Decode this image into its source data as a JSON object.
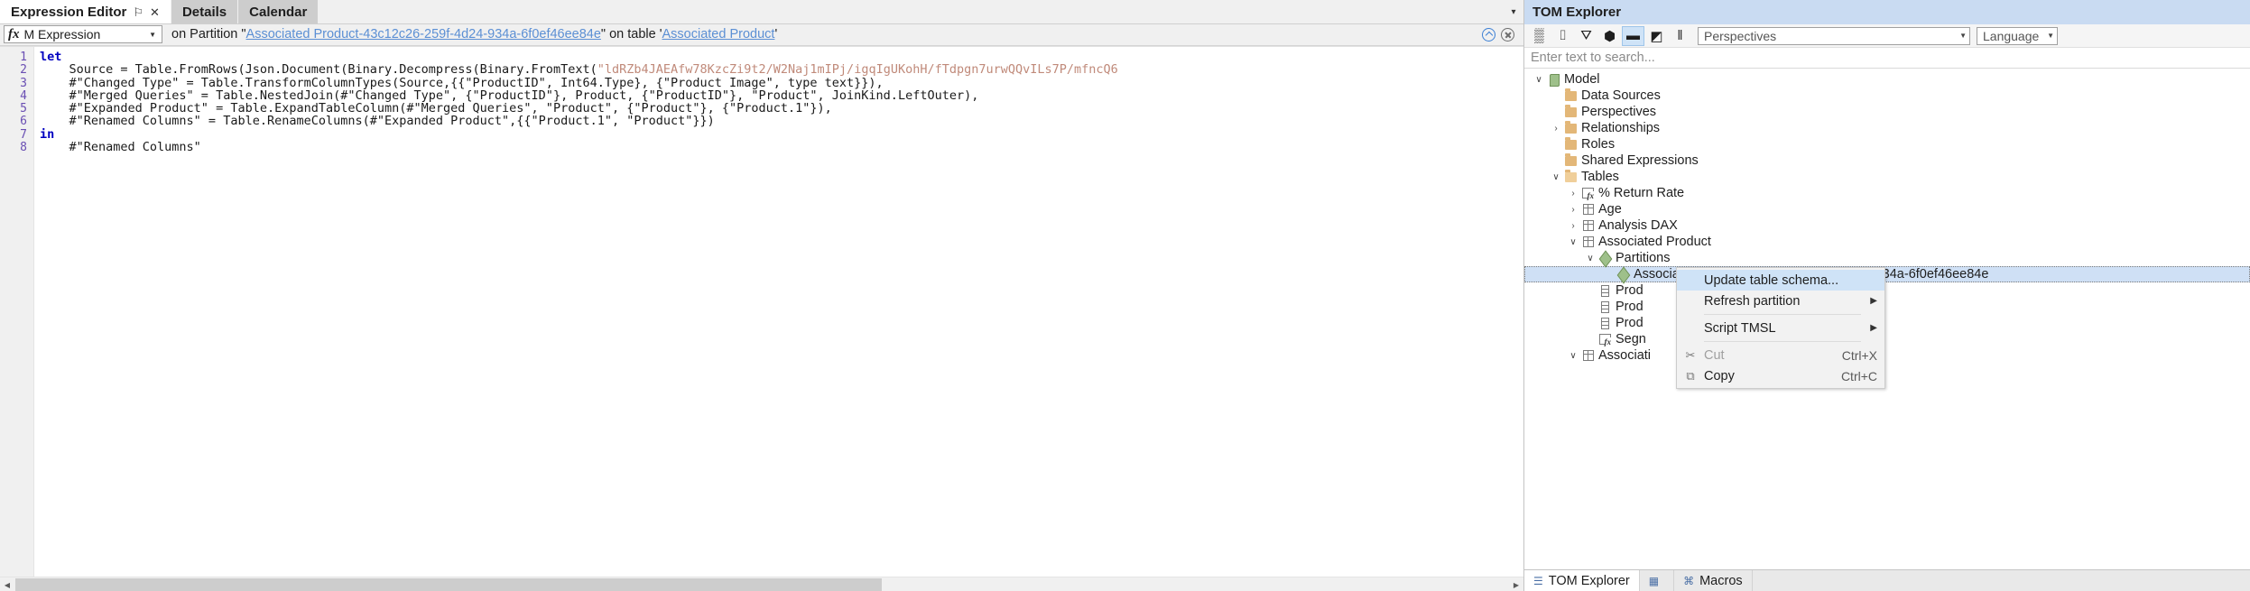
{
  "editor_pane": {
    "tabs": [
      {
        "label": "Expression Editor",
        "active": true,
        "pin": "⚐",
        "close": "✕"
      },
      {
        "label": "Details",
        "active": false,
        "pin": "",
        "close": ""
      },
      {
        "label": "Calendar",
        "active": false,
        "pin": "",
        "close": ""
      }
    ],
    "tabstrip_overflow_icon": "▾",
    "toolbar": {
      "fx_glyph": "fx",
      "expression_kind": "M Expression",
      "dropdown_arrow": "▼",
      "caption_prefix": "on Partition \"",
      "partition_link": "Associated Product-43c12c26-259f-4d24-934a-6f0ef46ee84e",
      "caption_middle": "\" on table '",
      "table_link": "Associated Product",
      "caption_suffix": "'",
      "refresh_icon": "refresh-circle-icon",
      "cancel_icon": "cancel-circle-icon"
    },
    "code_lines": [
      {
        "n": "1",
        "segments": [
          {
            "t": "let",
            "c": "kw"
          }
        ]
      },
      {
        "n": "2",
        "segments": [
          {
            "t": "    Source = Table.FromRows(Json.Document(Binary.Decompress(Binary.FromText(",
            "c": "plain"
          },
          {
            "t": "\"ldRZb4JAEAfw78KzcZi9t2/W2Naj1mIPj/igqIgUKohH/fTdpgn7urwQQvILs7P/mfncQ6",
            "c": "str"
          }
        ]
      },
      {
        "n": "3",
        "segments": [
          {
            "t": "    #\"Changed Type\" = Table.TransformColumnTypes(Source,{{\"ProductID\", Int64.Type}, {\"Product Image\", type text}}),",
            "c": "plain"
          }
        ]
      },
      {
        "n": "4",
        "segments": [
          {
            "t": "    #\"Merged Queries\" = Table.NestedJoin(#\"Changed Type\", {\"ProductID\"}, Product, {\"ProductID\"}, \"Product\", JoinKind.LeftOuter),",
            "c": "plain"
          }
        ]
      },
      {
        "n": "5",
        "segments": [
          {
            "t": "    #\"Expanded Product\" = Table.ExpandTableColumn(#\"Merged Queries\", \"Product\", {\"Product\"}, {\"Product.1\"}),",
            "c": "plain"
          }
        ]
      },
      {
        "n": "6",
        "segments": [
          {
            "t": "    #\"Renamed Columns\" = Table.RenameColumns(#\"Expanded Product\",{{\"Product.1\", \"Product\"}})",
            "c": "plain"
          }
        ]
      },
      {
        "n": "7",
        "segments": [
          {
            "t": "in",
            "c": "kw"
          }
        ]
      },
      {
        "n": "8",
        "segments": [
          {
            "t": "    #\"Renamed Columns\"",
            "c": "plain"
          }
        ]
      }
    ],
    "scroll_left_arrow": "◀",
    "scroll_right_arrow": "▶"
  },
  "tom_explorer": {
    "title": "TOM Explorer",
    "toolbar_buttons": [
      {
        "name": "measures-toggle-icon",
        "glyph": "▒",
        "selected": false
      },
      {
        "name": "columns-toggle-icon",
        "glyph": "⌷",
        "selected": false
      },
      {
        "name": "hierarchies-toggle-icon",
        "glyph": "⛛",
        "selected": false
      },
      {
        "name": "partitions-toggle-icon",
        "glyph": "⬢",
        "selected": false
      },
      {
        "name": "folders-toggle-icon",
        "glyph": "▬",
        "selected": true
      },
      {
        "name": "hidden-objects-toggle-icon",
        "glyph": "◩",
        "selected": false
      },
      {
        "name": "columns-view-icon",
        "glyph": "‖",
        "selected": false
      }
    ],
    "perspectives_combo": {
      "value": "Perspectives",
      "arrow": "▼"
    },
    "language_combo": {
      "value": "Language",
      "arrow": "▼"
    },
    "search_placeholder": "Enter text to search...",
    "tree": [
      {
        "depth": 0,
        "chev": "∨",
        "icon": "model-icon",
        "label": "Model"
      },
      {
        "depth": 1,
        "chev": "",
        "icon": "folder-icon",
        "label": "Data Sources"
      },
      {
        "depth": 1,
        "chev": "",
        "icon": "folder-icon",
        "label": "Perspectives"
      },
      {
        "depth": 1,
        "chev": "›",
        "icon": "folder-icon",
        "label": "Relationships"
      },
      {
        "depth": 1,
        "chev": "",
        "icon": "folder-icon",
        "label": "Roles"
      },
      {
        "depth": 1,
        "chev": "",
        "icon": "folder-icon",
        "label": "Shared Expressions"
      },
      {
        "depth": 1,
        "chev": "∨",
        "icon": "folder-open-icon",
        "label": "Tables"
      },
      {
        "depth": 2,
        "chev": "›",
        "icon": "measure-table-icon",
        "label": "% Return Rate"
      },
      {
        "depth": 2,
        "chev": "›",
        "icon": "table-icon",
        "label": "Age"
      },
      {
        "depth": 2,
        "chev": "›",
        "icon": "table-icon",
        "label": "Analysis DAX"
      },
      {
        "depth": 2,
        "chev": "∨",
        "icon": "table-icon",
        "label": "Associated Product"
      },
      {
        "depth": 3,
        "chev": "∨",
        "icon": "partition-icon",
        "label": "Partitions"
      },
      {
        "depth": 4,
        "chev": "",
        "icon": "partition-icon",
        "label": "Associated Product-43c12c26-259f-4d24-934a-6f0ef46ee84e",
        "selected": true
      },
      {
        "depth": 3,
        "chev": "",
        "icon": "column-icon",
        "label": "Prod"
      },
      {
        "depth": 3,
        "chev": "",
        "icon": "column-icon",
        "label": "Prod"
      },
      {
        "depth": 3,
        "chev": "",
        "icon": "column-icon",
        "label": "Prod"
      },
      {
        "depth": 3,
        "chev": "",
        "icon": "measure-table-icon",
        "label": "Segn"
      },
      {
        "depth": 2,
        "chev": "∨",
        "icon": "table-icon",
        "label": "Associati"
      }
    ],
    "context_menu": [
      {
        "label": "Update table schema...",
        "icon": "",
        "accel": "",
        "submenu": false,
        "highlight": true,
        "disabled": false,
        "separator_after": false
      },
      {
        "label": "Refresh partition",
        "icon": "",
        "accel": "",
        "submenu": true,
        "highlight": false,
        "disabled": false,
        "separator_after": true
      },
      {
        "label": "Script TMSL",
        "icon": "",
        "accel": "",
        "submenu": true,
        "highlight": false,
        "disabled": false,
        "separator_after": true
      },
      {
        "label": "Cut",
        "icon": "scissors-icon",
        "accel": "Ctrl+X",
        "submenu": false,
        "highlight": false,
        "disabled": true,
        "separator_after": false
      },
      {
        "label": "Copy",
        "icon": "copy-icon",
        "accel": "Ctrl+C",
        "submenu": false,
        "highlight": false,
        "disabled": false,
        "separator_after": false
      }
    ],
    "submenu_arrow": "▶",
    "dock_tabs": [
      {
        "label": "TOM Explorer",
        "icon": "tree-icon",
        "active": true
      },
      {
        "label": "",
        "icon": "table-icon",
        "active": false
      },
      {
        "label": "Macros",
        "icon": "macro-icon",
        "active": false
      }
    ]
  }
}
